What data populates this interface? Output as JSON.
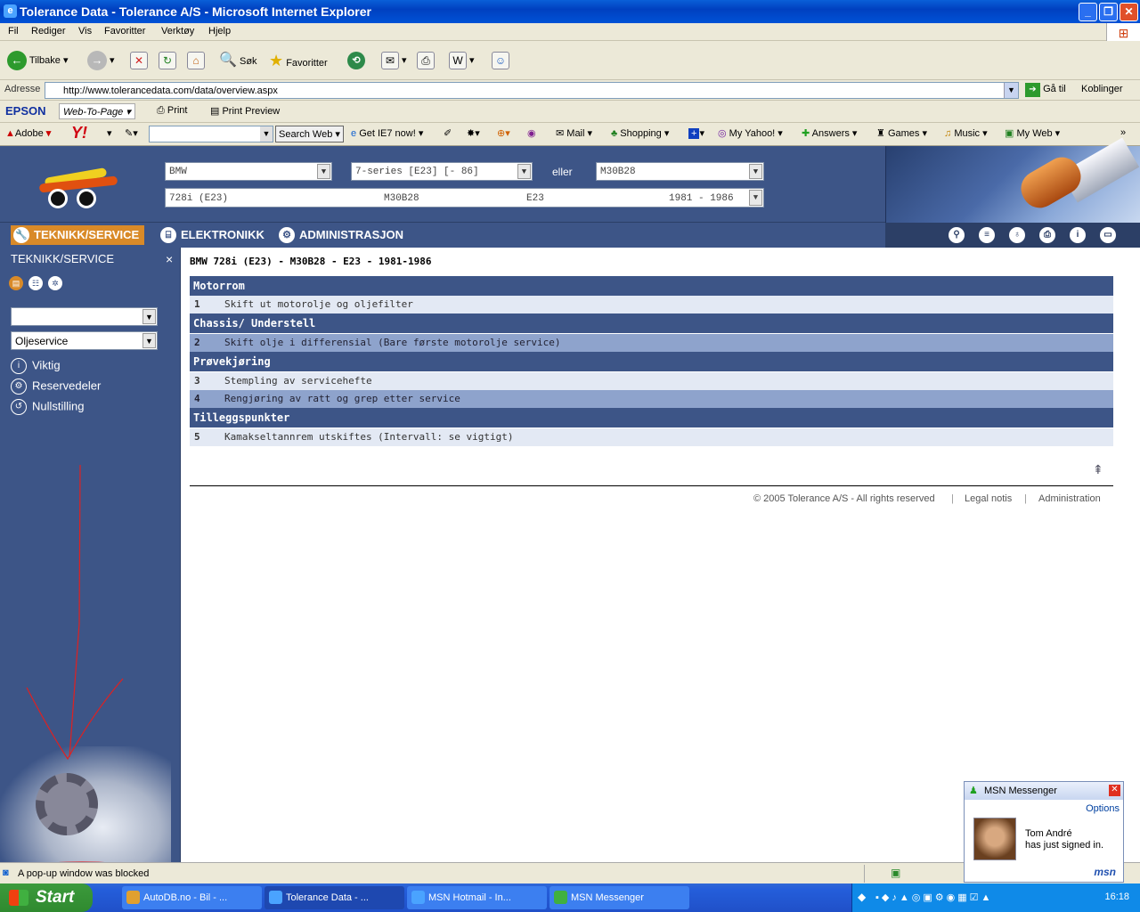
{
  "window": {
    "title": "Tolerance Data - Tolerance A/S - Microsoft Internet Explorer"
  },
  "menu": [
    "Fil",
    "Rediger",
    "Vis",
    "Favoritter",
    "Verktøy",
    "Hjelp"
  ],
  "toolbar": {
    "back": "Tilbake",
    "search": "Søk",
    "favorites": "Favoritter"
  },
  "address": {
    "label": "Adresse",
    "url": "http://www.tolerancedata.com/data/overview.aspx",
    "go": "Gå til",
    "links": "Koblinger"
  },
  "epson": {
    "brand": "EPSON",
    "web_to_page": "Web-To-Page",
    "print": "Print",
    "print_preview": "Print Preview"
  },
  "yahoo_bar": {
    "adobe": "Adobe",
    "search_web": "Search Web",
    "get_ie7": "Get IE7 now!",
    "mail": "Mail",
    "shopping": "Shopping",
    "my_yahoo": "My Yahoo!",
    "answers": "Answers",
    "games": "Games",
    "music": "Music",
    "my_web": "My Web"
  },
  "header": {
    "make": "BMW",
    "model": "7-series [E23] [- 86]",
    "or_label": "eller",
    "engine": "M30B28",
    "info": {
      "variant": "728i (E23)",
      "engine": "M30B28",
      "chassis": "E23",
      "years": "1981 - 1986"
    }
  },
  "nav": {
    "tabs": [
      "TEKNIKK/SERVICE",
      "ELEKTRONIKK",
      "ADMINISTRASJON"
    ]
  },
  "sidebar": {
    "title": "TEKNIKK/SERVICE",
    "close": "×",
    "service_select": "Oljeservice",
    "items": [
      "Viktig",
      "Reservedeler",
      "Nullstilling"
    ]
  },
  "content": {
    "title": "BMW 728i (E23) - M30B28 - E23 - 1981-1986",
    "sections": [
      {
        "heading": "Motorrom",
        "rows": [
          {
            "n": "1",
            "text": "Skift ut motorolje og oljefilter"
          }
        ]
      },
      {
        "heading": "Chassis/ Understell",
        "rows": [
          {
            "n": "2",
            "text": "Skift olje i differensial (Bare første motorolje service)"
          }
        ]
      },
      {
        "heading": "Prøvekjøring",
        "rows": [
          {
            "n": "3",
            "text": "Stempling av servicehefte"
          },
          {
            "n": "4",
            "text": "Rengjøring av ratt og grep etter service"
          }
        ]
      },
      {
        "heading": "Tilleggspunkter",
        "rows": [
          {
            "n": "5",
            "text": "Kamakseltannrem utskiftes (Intervall: se vigtigt)"
          }
        ]
      }
    ]
  },
  "footer": {
    "copyright": "© 2005 Tolerance A/S - All rights reserved",
    "legal": "Legal notis",
    "admin": "Administration"
  },
  "status": {
    "message": "A pop-up window was blocked"
  },
  "taskbar": {
    "start": "Start",
    "tasks": [
      "AutoDB.no - Bil - ...",
      "Tolerance Data - ...",
      "MSN Hotmail - In...",
      "MSN Messenger"
    ],
    "clock": "16:18"
  },
  "msn_popup": {
    "title": "MSN Messenger",
    "options": "Options",
    "name": "Tom André",
    "message": "has just signed in.",
    "logo": "msn"
  },
  "colors": {
    "page_blue": "#3d5587",
    "accent_orange": "#d98a28"
  }
}
